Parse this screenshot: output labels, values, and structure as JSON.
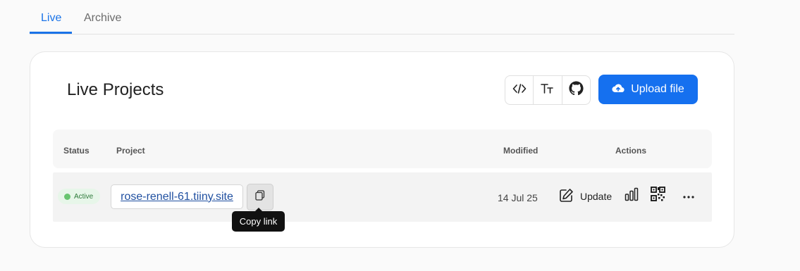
{
  "tabs": [
    {
      "label": "Live",
      "active": true
    },
    {
      "label": "Archive",
      "active": false
    }
  ],
  "card": {
    "title": "Live Projects",
    "toolbar": {
      "icons": [
        "code-icon",
        "text-format-icon",
        "github-icon"
      ],
      "upload_label": "Upload file"
    }
  },
  "table": {
    "headers": {
      "status": "Status",
      "project": "Project",
      "modified": "Modified",
      "actions": "Actions"
    },
    "rows": [
      {
        "status": "Active",
        "project": "rose-renell-61.tiiny.site",
        "modified": "14 Jul 25",
        "update_label": "Update"
      }
    ]
  },
  "tooltip": "Copy link",
  "colors": {
    "accent": "#1570ef",
    "active_tab": "#1a73e8",
    "badge_bg": "#e7f6e9",
    "badge_dot": "#67c56f"
  }
}
